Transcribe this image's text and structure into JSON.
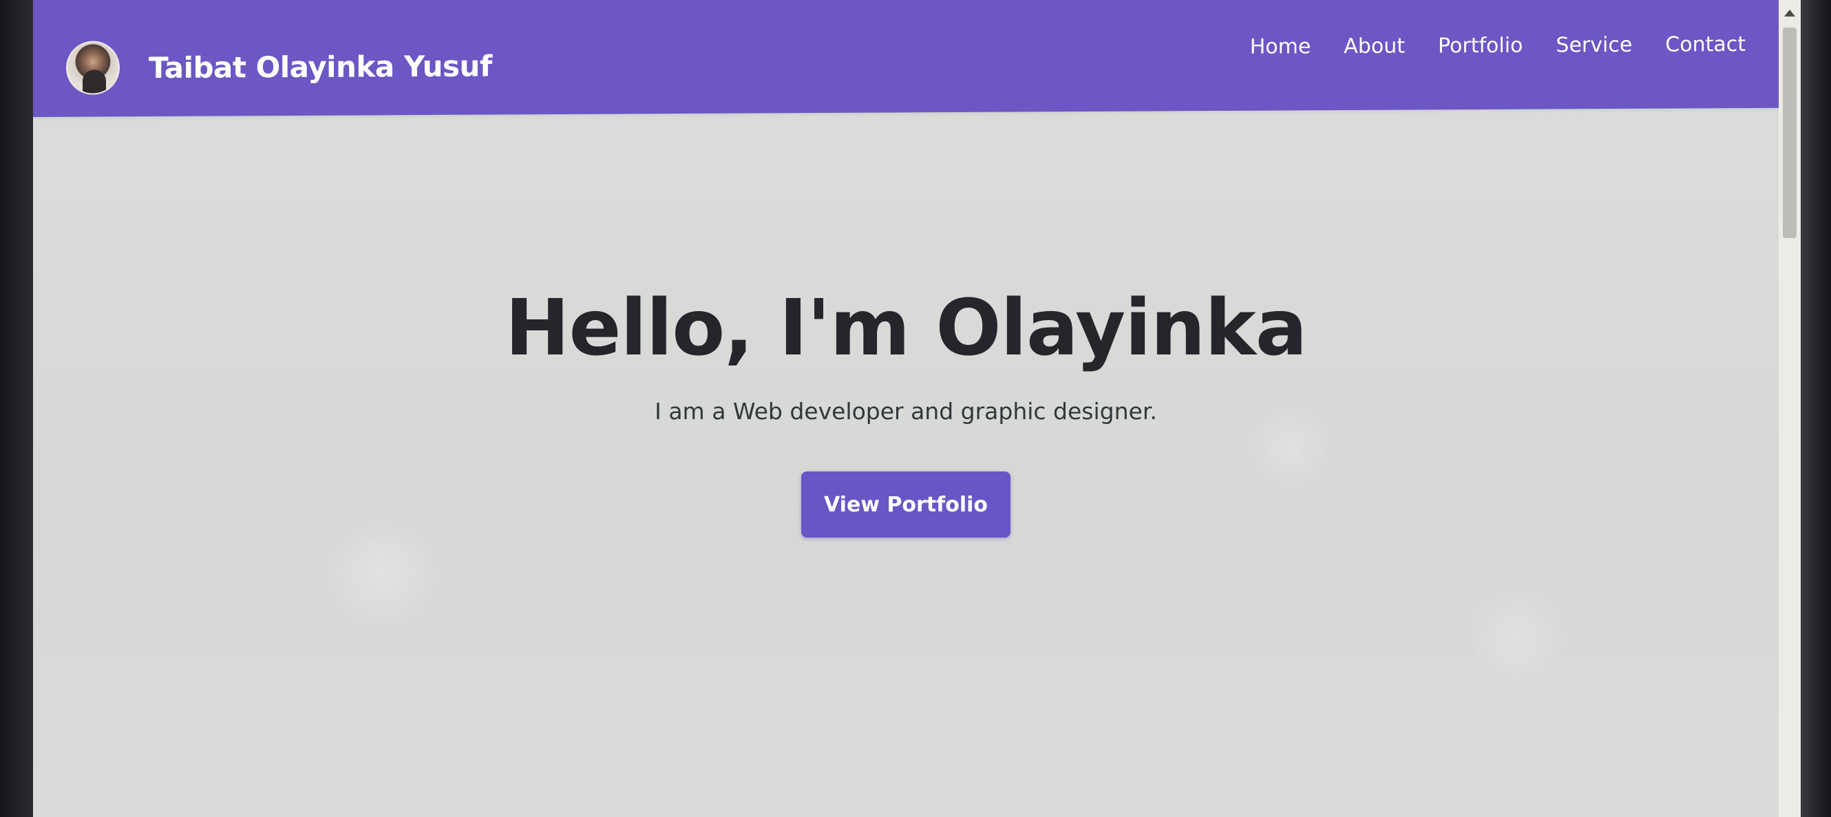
{
  "navbar": {
    "brand_name": "Taibat Olayinka Yusuf",
    "links": [
      {
        "label": "Home"
      },
      {
        "label": "About"
      },
      {
        "label": "Portfolio"
      },
      {
        "label": "Service"
      },
      {
        "label": "Contact"
      }
    ],
    "background_color": "#6c57c4"
  },
  "hero": {
    "title": "Hello, I'm Olayinka",
    "subtitle": "I am a Web developer and graphic designer.",
    "cta_label": "View Portfolio",
    "cta_color": "#6a55c6"
  },
  "icons": {
    "scroll_up": "chevron-up-icon",
    "avatar": "profile-photo"
  }
}
